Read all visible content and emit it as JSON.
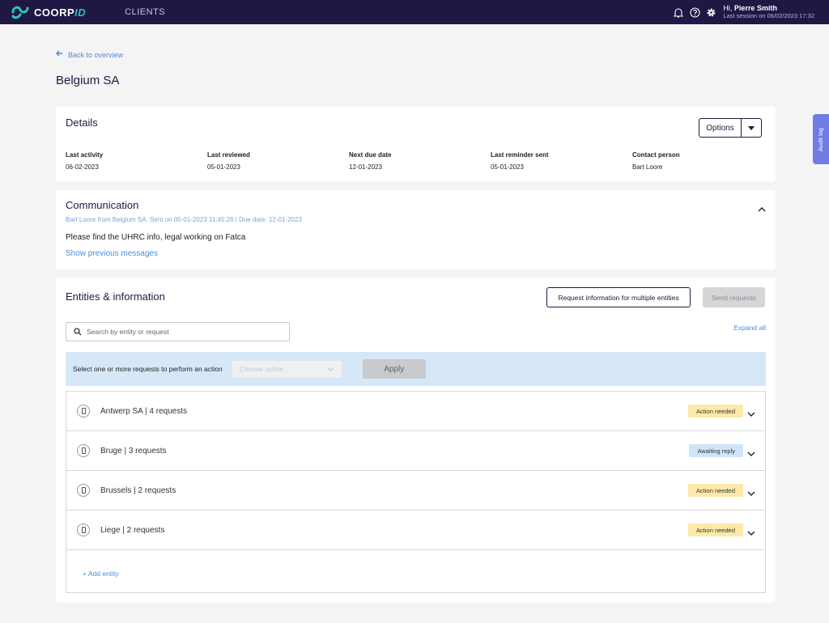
{
  "topbar": {
    "brand_main": "COORP",
    "brand_accent": "ID",
    "nav_clients": "CLIENTS",
    "icons": [
      "bell-icon",
      "help-icon",
      "gear-icon"
    ],
    "greeting": "Hi,",
    "user_name": "Pierre Smith",
    "last_session": "Last session on  06/02/2023 17:32"
  },
  "back_link": "Back to overview",
  "page_title": "Belgium SA",
  "details": {
    "title": "Details",
    "options_label": "Options",
    "fields": [
      {
        "label": "Last activity",
        "value": "06-02-2023"
      },
      {
        "label": "Last reviewed",
        "value": "05-01-2023"
      },
      {
        "label": "Next due date",
        "value": "12-01-2023"
      },
      {
        "label": "Last reminder sent",
        "value": "05-01-2023"
      },
      {
        "label": "Contact person",
        "value": "Bart Loore"
      }
    ]
  },
  "communication": {
    "title": "Communication",
    "meta": "Bart Loore from Belgium SA. Sent on 05-01-2023 11:45:26 | Due date: 12-01-2023",
    "message": "Please find the UHRC info, legal working on Fatca",
    "show_previous": "Show previous messages"
  },
  "entities": {
    "title": "Entities & information",
    "request_multi_label": "Request information for multiple entities",
    "send_label": "Send requests",
    "search_placeholder": "Search by entity or request",
    "expand_all": "Expand all",
    "action_bar_label": "Select one or more requests to perform an action",
    "choose_action_placeholder": "Choose action",
    "apply_label": "Apply",
    "rows": [
      {
        "name": "Antwerp SA | 4 requests",
        "status": "Action needed",
        "status_type": "action"
      },
      {
        "name": "Bruge | 3 requests",
        "status": "Awaiting reply",
        "status_type": "waiting"
      },
      {
        "name": "Brussels | 2 requests",
        "status": "Action needed",
        "status_type": "action"
      },
      {
        "name": "Liege | 2 requests",
        "status": "Action needed",
        "status_type": "action"
      }
    ],
    "add_entity": "+ Add entity"
  },
  "audit_log": "Audit log",
  "colors": {
    "topbar": "#1f1845",
    "link": "#4a8fd8",
    "action_needed": "#fde9a8",
    "awaiting_reply": "#d0e4f8",
    "audit_tab": "#6f7ce6"
  }
}
